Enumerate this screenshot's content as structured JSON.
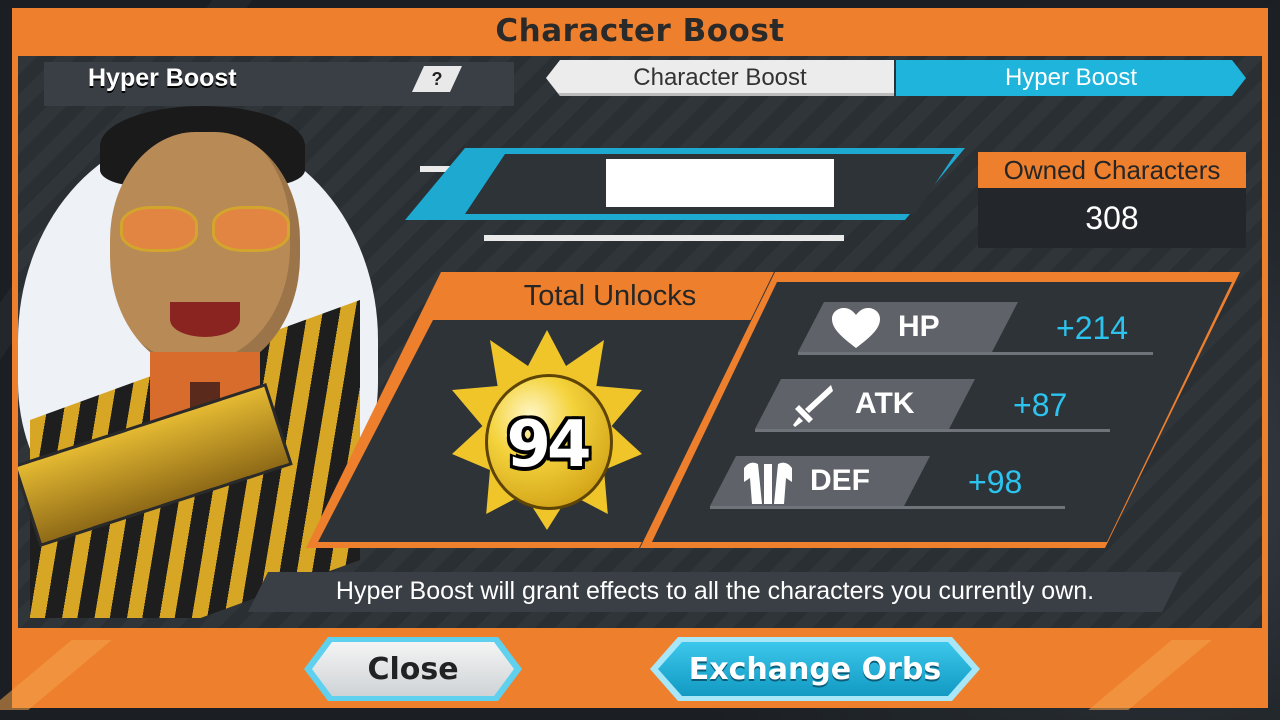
{
  "window": {
    "title": "Character Boost"
  },
  "header": {
    "section_title": "Hyper Boost",
    "help_label": "?"
  },
  "tabs": [
    {
      "label": "Character Boost",
      "active": false
    },
    {
      "label": "Hyper Boost",
      "active": true
    }
  ],
  "owned": {
    "label": "Owned Characters",
    "value": "308"
  },
  "total_unlocks": {
    "label": "Total Unlocks",
    "value": "94"
  },
  "stats": [
    {
      "icon": "heart-icon",
      "label": "HP",
      "value": "+214"
    },
    {
      "icon": "sword-icon",
      "label": "ATK",
      "value": "+87"
    },
    {
      "icon": "armor-icon",
      "label": "DEF",
      "value": "+98"
    }
  ],
  "message": "Hyper Boost will grant effects to all the characters you currently own.",
  "buttons": {
    "close": "Close",
    "exchange": "Exchange Orbs"
  },
  "colors": {
    "accent_orange": "#ee7f2c",
    "accent_cyan": "#1fb4db",
    "panel_dark": "#2e3338",
    "stat_value": "#2cc4ee"
  }
}
